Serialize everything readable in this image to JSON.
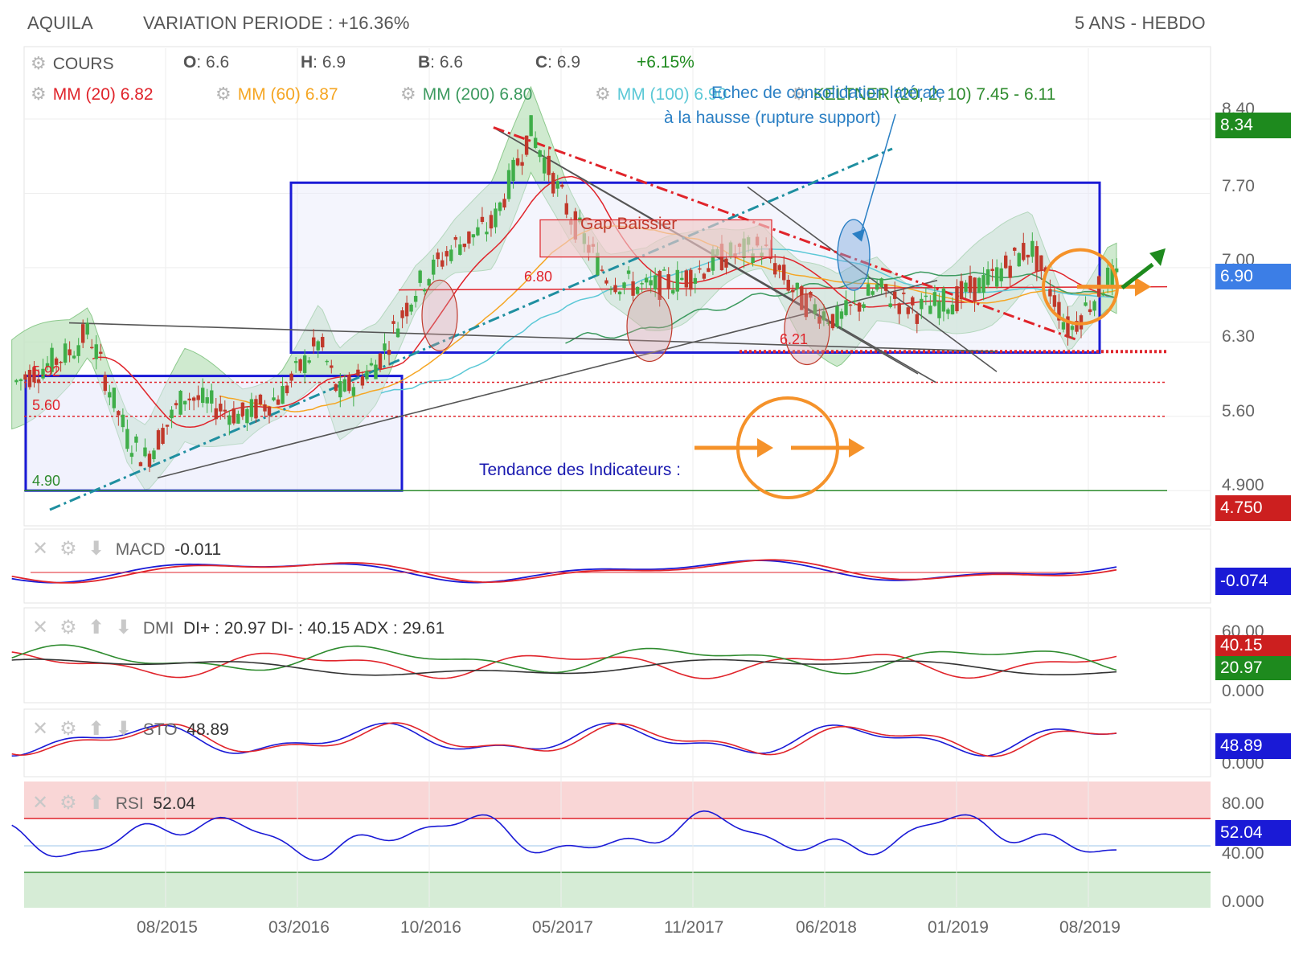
{
  "header": {
    "ticker": "AQUILA",
    "variation": "VARIATION PERIODE : +16.36%",
    "period": "5 ANS - HEBDO"
  },
  "legend": {
    "cours": "COURS",
    "ohlc": [
      {
        "k": "O",
        "v": ": 6.6"
      },
      {
        "k": "H",
        "v": ": 6.9"
      },
      {
        "k": "B",
        "v": ": 6.6"
      },
      {
        "k": "C",
        "v": ": 6.9"
      }
    ],
    "change": "+6.15%",
    "mm": [
      {
        "label": "MM (20) 6.82",
        "color": "#e0242b"
      },
      {
        "label": "MM (60) 6.87",
        "color": "#f5a623"
      },
      {
        "label": "MM (200) 6.80",
        "color": "#3c9a5f"
      },
      {
        "label": "MM (100) 6.90",
        "color": "#5bc8d6"
      }
    ],
    "keltner": "KELTNER (20, 2, 10) 7.45 - 6.11",
    "keltner_color": "#2e8b2e"
  },
  "annotations": {
    "gap": "Gap Baissier",
    "echec_line1": "Echec de consolidation latérale",
    "echec_line2": "à la hausse (rupture support)",
    "tendance": "Tendance des Indicateurs :",
    "lvl_680": "6.80",
    "lvl_621": "6.21",
    "lvl_592": "5.92",
    "lvl_560": "5.60",
    "lvl_490": "4.90"
  },
  "price_axis": {
    "ticks": [
      "8.40",
      "7.70",
      "7.00",
      "6.30",
      "5.60",
      "4.900"
    ],
    "badges": [
      {
        "label": "8.34",
        "value": 8.34,
        "color": "#1e8a1e"
      },
      {
        "label": "6.90",
        "value": 6.9,
        "color": "#3c7ee6"
      },
      {
        "label": "4.750",
        "value": 4.75,
        "color": "#cc1f1f"
      }
    ]
  },
  "macd": {
    "label": "MACD",
    "value": "-0.011",
    "badge": "-0.074"
  },
  "dmi": {
    "label": "DMI",
    "value": "DI+ : 20.97 DI- : 40.15 ADX : 29.61",
    "ticks": [
      "60.00",
      "0.000"
    ],
    "badge_red": "40.15",
    "badge_green": "20.97"
  },
  "sto": {
    "label": "STO",
    "value": "48.89",
    "ticks": [
      "0.000"
    ],
    "badge": "48.89"
  },
  "rsi": {
    "label": "RSI",
    "value": "52.04",
    "ticks": [
      "80.00",
      "40.00",
      "0.000"
    ],
    "badge": "52.04"
  },
  "x_axis": [
    "08/2015",
    "03/2016",
    "10/2016",
    "05/2017",
    "11/2017",
    "06/2018",
    "01/2019",
    "08/2019"
  ],
  "colors": {
    "up": "#3fae49",
    "down": "#c0392b",
    "frame": "#1a1ad6",
    "orange": "#f5922a",
    "keltner_fill": "#bfe3bf",
    "trend_blue": "#1f8fa0",
    "red_trend": "#e0242b"
  },
  "chart_data": {
    "type": "candlestick",
    "title": "AQUILA",
    "ylim": [
      4.75,
      8.4
    ],
    "x": [
      "08/2015",
      "03/2016",
      "10/2016",
      "05/2017",
      "11/2017",
      "06/2018",
      "01/2019",
      "08/2019"
    ],
    "close_path": [
      {
        "x": "2014-12",
        "y": 5.9
      },
      {
        "x": "2015-03",
        "y": 6.2
      },
      {
        "x": "2015-04",
        "y": 6.4
      },
      {
        "x": "2015-06",
        "y": 5.4
      },
      {
        "x": "2015-07",
        "y": 5.2
      },
      {
        "x": "2015-09",
        "y": 5.8
      },
      {
        "x": "2015-12",
        "y": 5.6
      },
      {
        "x": "2016-02",
        "y": 5.8
      },
      {
        "x": "2016-04",
        "y": 6.3
      },
      {
        "x": "2016-05",
        "y": 5.8
      },
      {
        "x": "2016-07",
        "y": 6.1
      },
      {
        "x": "2016-09",
        "y": 6.8
      },
      {
        "x": "2016-11",
        "y": 7.2
      },
      {
        "x": "2017-01",
        "y": 7.4
      },
      {
        "x": "2017-03",
        "y": 8.3
      },
      {
        "x": "2017-05",
        "y": 7.5
      },
      {
        "x": "2017-07",
        "y": 6.9
      },
      {
        "x": "2017-09",
        "y": 6.8
      },
      {
        "x": "2017-11",
        "y": 6.9
      },
      {
        "x": "2018-01",
        "y": 7.1
      },
      {
        "x": "2018-03",
        "y": 7.2
      },
      {
        "x": "2018-05",
        "y": 6.7
      },
      {
        "x": "2018-07",
        "y": 6.5
      },
      {
        "x": "2018-09",
        "y": 6.8
      },
      {
        "x": "2018-11",
        "y": 6.6
      },
      {
        "x": "2019-01",
        "y": 6.7
      },
      {
        "x": "2019-03",
        "y": 6.9
      },
      {
        "x": "2019-05",
        "y": 7.2
      },
      {
        "x": "2019-07",
        "y": 6.4
      },
      {
        "x": "2019-09",
        "y": 6.9
      }
    ],
    "levels": [
      8.34,
      6.9,
      6.8,
      6.21,
      5.92,
      5.6,
      4.9,
      4.75
    ],
    "last": {
      "open": 6.6,
      "high": 6.9,
      "low": 6.6,
      "close": 6.9,
      "change": "+6.15%"
    }
  }
}
